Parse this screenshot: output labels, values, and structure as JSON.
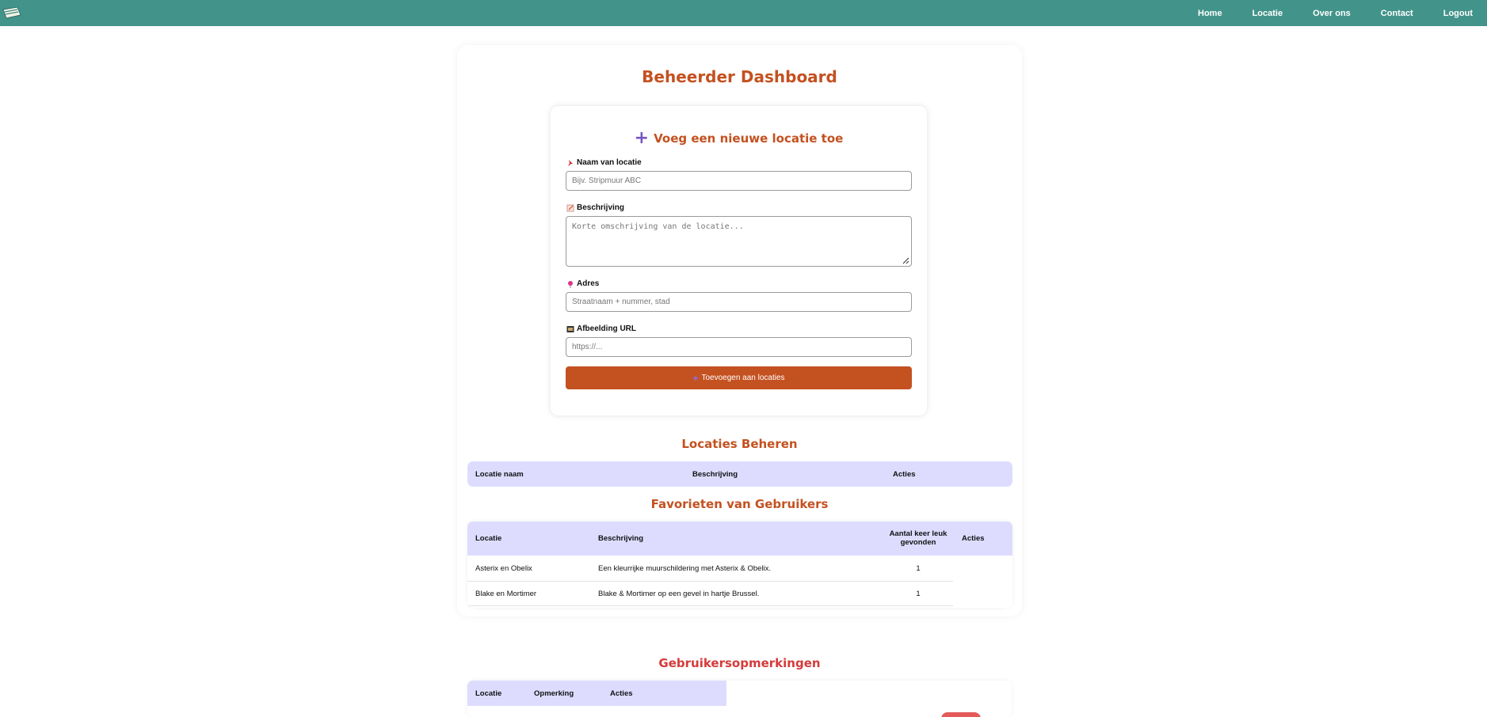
{
  "nav": {
    "items": [
      "Home",
      "Locatie",
      "Over ons",
      "Contact",
      "Logout"
    ]
  },
  "dashboard_title": "Beheerder Dashboard",
  "form": {
    "title": "Voeg een nieuwe locatie toe",
    "fields": {
      "name": {
        "label": "Naam van locatie",
        "placeholder": "Bijv. Stripmuur ABC",
        "icon": "pushpin-icon"
      },
      "description": {
        "label": "Beschrijving",
        "placeholder": "Korte omschrijving van de locatie...",
        "icon": "memo-icon"
      },
      "address": {
        "label": "Adres",
        "placeholder": "Straatnaam + nummer, stad",
        "icon": "map-pin-icon"
      },
      "image": {
        "label": "Afbeelding URL",
        "placeholder": "https://...",
        "icon": "image-icon"
      }
    },
    "submit_label": "Toevoegen aan locaties"
  },
  "locations_section": {
    "title": "Locaties Beheren",
    "headers": [
      "Locatie naam",
      "Beschrijving",
      "Acties"
    ]
  },
  "favorites_section": {
    "title": "Favorieten van Gebruikers",
    "headers": [
      "Locatie",
      "Beschrijving",
      "Aantal keer leuk gevonden",
      "Acties"
    ],
    "rows": [
      {
        "location": "Asterix en Obelix",
        "description": "Een kleurrijke muurschildering met Asterix & Obelix.",
        "count": "1"
      },
      {
        "location": "Blake en Mortimer",
        "description": "Blake & Mortimer op een gevel in hartje Brussel.",
        "count": "1"
      }
    ]
  },
  "comments_section": {
    "title": "Gebruikersopmerkingen",
    "headers": [
      "Locatie",
      "Opmerking",
      "Acties"
    ]
  },
  "colors": {
    "nav_bg": "#42948a",
    "accent": "#c45120",
    "header_bg": "#dddcff",
    "plus": "#7654c4",
    "danger": "#d53a3a"
  }
}
